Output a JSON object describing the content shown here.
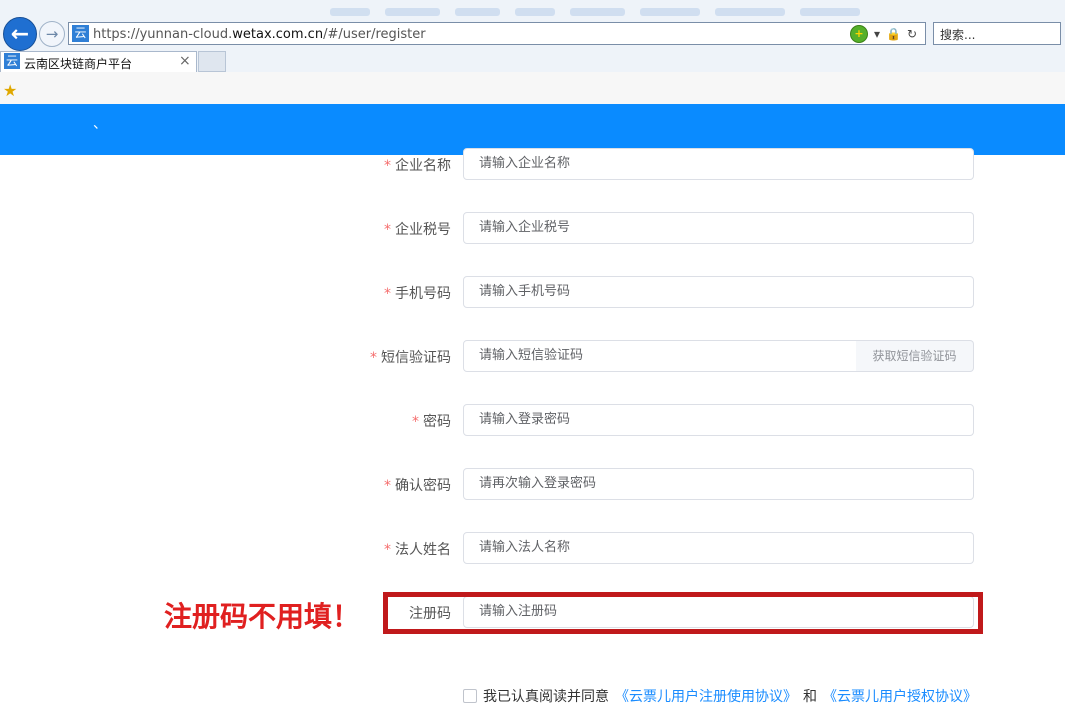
{
  "browser": {
    "url_prefix": "https://yunnan-cloud.",
    "url_host": "wetax.com.cn",
    "url_path": "/#/user/register",
    "search_placeholder": "搜索...",
    "tab_title": "云南区块链商户平台",
    "favicon_char": "云",
    "tab_close": "×"
  },
  "header": {
    "mark": "、"
  },
  "form": {
    "required_mark": "*",
    "company_name": {
      "label": "企业名称",
      "placeholder": "请输入企业名称"
    },
    "tax_id": {
      "label": "企业税号",
      "placeholder": "请输入企业税号"
    },
    "phone": {
      "label": "手机号码",
      "placeholder": "请输入手机号码"
    },
    "sms_code": {
      "label": "短信验证码",
      "placeholder": "请输入短信验证码",
      "button": "获取短信验证码"
    },
    "password": {
      "label": "密码",
      "placeholder": "请输入登录密码"
    },
    "confirm_password": {
      "label": "确认密码",
      "placeholder": "请再次输入登录密码"
    },
    "legal_person": {
      "label": "法人姓名",
      "placeholder": "请输入法人名称"
    },
    "reg_code": {
      "label": "注册码",
      "placeholder": "请输入注册码"
    }
  },
  "annotation": {
    "note": "注册码不用填！",
    "color": "#e02020"
  },
  "agreement": {
    "text": "我已认真阅读并同意",
    "link1": "《云票儿用户注册使用协议》",
    "and": "和",
    "link2": "《云票儿用户授权协议》"
  },
  "colors": {
    "header_blue": "#0a8bff",
    "link_blue": "#1a8cff",
    "required_red": "#f56c6c",
    "box_red": "#c0191b"
  }
}
